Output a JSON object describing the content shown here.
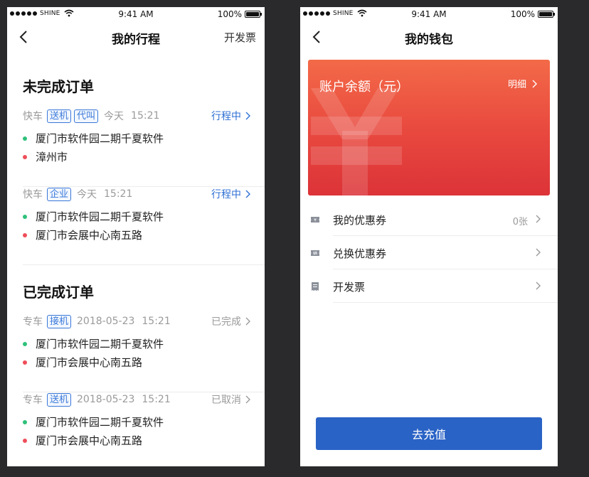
{
  "status_bar": {
    "carrier": "SHINE",
    "time": "9:41 AM",
    "battery": "100%"
  },
  "trips_screen": {
    "title": "我的行程",
    "action": "开发票",
    "unfinished_section": "未完成订单",
    "finished_section": "已完成订单",
    "unfinished_orders": [
      {
        "type": "快车",
        "tags": [
          "送机",
          "代叫"
        ],
        "day": "今天",
        "time": "15:21",
        "status": "行程中",
        "from": "厦门市软件园二期千夏软件",
        "to": "漳州市"
      },
      {
        "type": "快车",
        "tags": [
          "企业"
        ],
        "day": "今天",
        "time": "15:21",
        "status": "行程中",
        "from": "厦门市软件园二期千夏软件",
        "to": "厦门市会展中心南五路"
      }
    ],
    "finished_orders": [
      {
        "type": "专车",
        "tags": [
          "接机"
        ],
        "day": "2018-05-23",
        "time": "15:21",
        "status": "已完成",
        "from": "厦门市软件园二期千夏软件",
        "to": "厦门市会展中心南五路"
      },
      {
        "type": "专车",
        "tags": [
          "送机"
        ],
        "day": "2018-05-23",
        "time": "15:21",
        "status": "已取消",
        "from": "厦门市软件园二期千夏软件",
        "to": "厦门市会展中心南五路"
      }
    ]
  },
  "wallet_screen": {
    "title": "我的钱包",
    "balance_label": "账户余额（元）",
    "detail_link": "明细",
    "menu": [
      {
        "label": "我的优惠券",
        "value": "0张",
        "icon": "coupon-icon"
      },
      {
        "label": "兑换优惠券",
        "value": "",
        "icon": "exchange-icon"
      },
      {
        "label": "开发票",
        "value": "",
        "icon": "invoice-icon"
      }
    ],
    "recharge_button": "去充值"
  },
  "colors": {
    "accent_blue": "#2a63c6",
    "status_blue": "#2d6fd4",
    "card_top": "#f36a48",
    "card_bottom": "#dc3338",
    "dot_green": "#2fc07a",
    "dot_red": "#ee4e5a"
  }
}
